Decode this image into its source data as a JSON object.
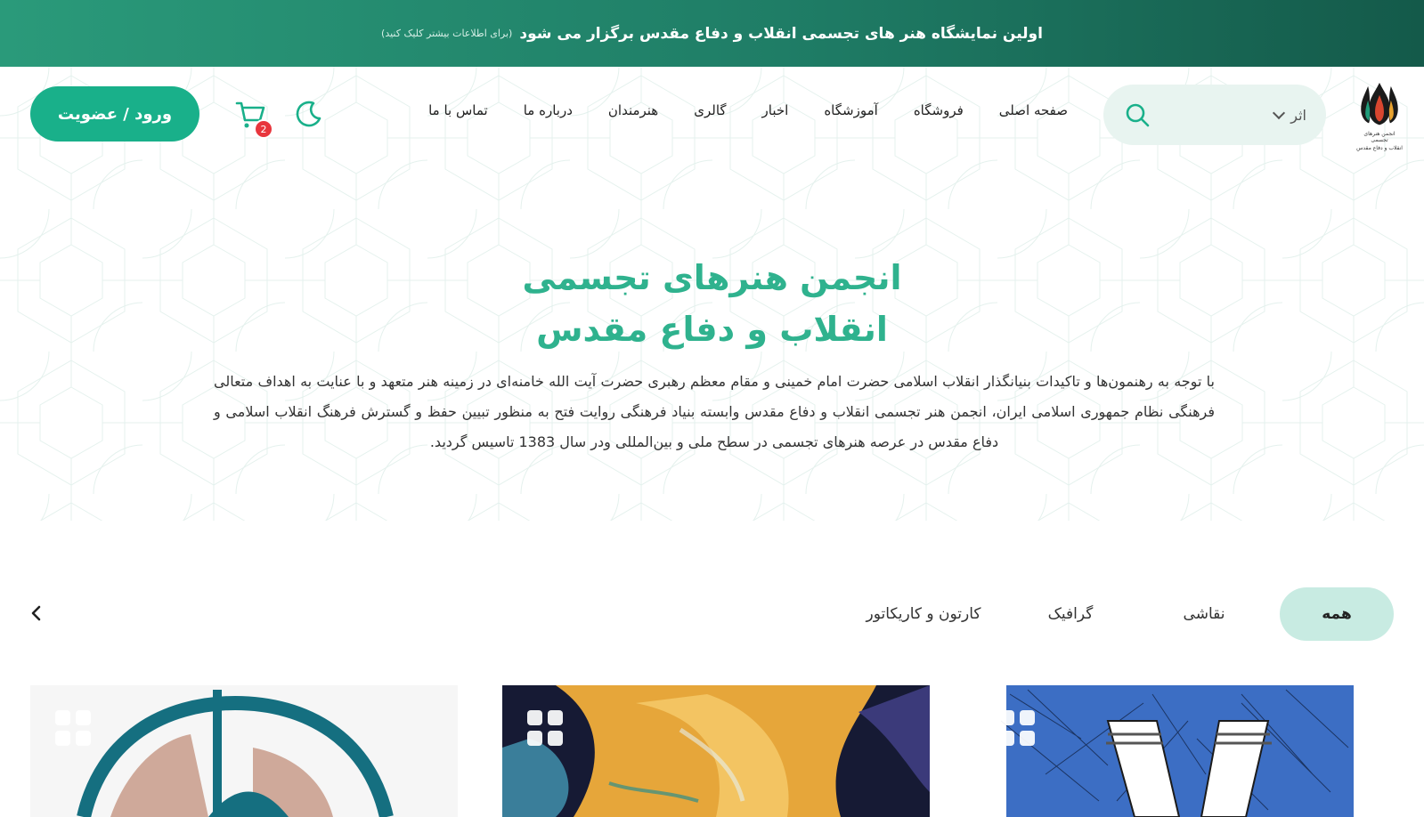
{
  "announcement": {
    "main": "اولین نمایشگاه هنر های تجسمی انقلاب و دفاع مقدس برگزار می شود",
    "note": "(برای اطلاعات بیشتر کلیک کنید)"
  },
  "logo": {
    "caption_line1": "انجمن هنرهای تجسمی",
    "caption_line2": "انقلاب و دفاع مقدس"
  },
  "search": {
    "type_label": "اثر"
  },
  "nav": [
    "صفحه اصلی",
    "فروشگاه",
    "آموزشگاه",
    "اخبار",
    "گالری",
    "هنرمندان",
    "درباره ما",
    "تماس با ما"
  ],
  "cart": {
    "count": "2"
  },
  "login": {
    "label": "ورود / عضویت"
  },
  "hero": {
    "title_line1": "انجمن هنرهای تجسمی",
    "title_line2": "انقلاب و دفاع مقدس",
    "text": "با توجه به رهنمون‌ها و تاکیدات بنیانگذار انقلاب اسلامی حضرت امام خمینی و مقام معظم رهبری حضرت آیت الله خامنه‌ای در زمینه هنر متعهد و با عنایت به اهداف متعالی فرهنگی نظام جمهوری اسلامی ایران، انجمن هنر تجسمی انقلاب و دفاع مقدس وابسته بنیاد فرهنگی روایت فتح به منظور تبیین حفظ و گسترش فرهنگ انقلاب اسلامی و دفاع مقدس در عرصه هنرهای تجسمی در سطح ملی و بین‌المللی ودر سال 1383 تاسیس گردید."
  },
  "tabs": [
    "همه",
    "نقاشی",
    "گرافیک",
    "کارتون و کاریکاتور"
  ],
  "colors": {
    "brand": "#19b08a",
    "title": "#2fb28e",
    "tab_active": "#c8ebe2",
    "search_bg": "#e8f4f0",
    "badge": "#e8363d"
  },
  "icons": [
    "search-icon",
    "chevron-down-icon",
    "moon-icon",
    "cart-icon",
    "chevron-left-icon",
    "grid-icon"
  ]
}
